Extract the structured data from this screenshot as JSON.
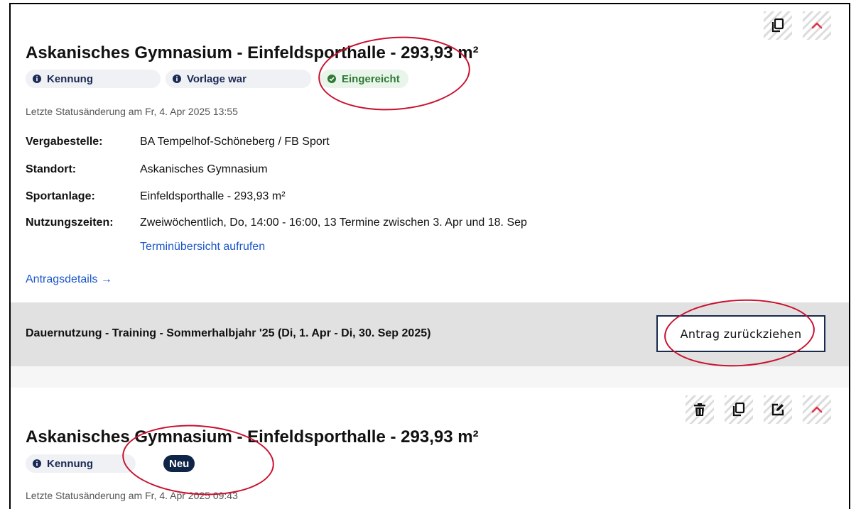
{
  "cards": [
    {
      "title": "Askanisches Gymnasium - Einfeldsporthalle - 293,93 m²",
      "badges": {
        "kennung": "Kennung",
        "vorlage": "Vorlage war",
        "status": "Eingereicht"
      },
      "last_status_change": "Letzte Statusänderung am Fr, 4. Apr 2025 13:55",
      "details": [
        {
          "label": "Vergabestelle:",
          "value": "BA Tempelhof-Schöneberg / FB Sport"
        },
        {
          "label": "Standort:",
          "value": "Askanisches Gymnasium"
        },
        {
          "label": "Sportanlage:",
          "value": "Einfeldsporthalle - 293,93 m²"
        },
        {
          "label": "Nutzungszeiten:",
          "value": "Zweiwöchentlich, Do, 14:00 - 16:00, 13 Termine zwischen 3. Apr und 18. Sep"
        }
      ],
      "schedule_link": "Terminübersicht aufrufen",
      "details_link": "Antragsdetails →",
      "usage_period": "Dauernutzung - Training - Sommerhalbjahr '25 (Di, 1. Apr - Di, 30. Sep 2025)",
      "withdraw_button": "Antrag zurückziehen",
      "icons": [
        "copy-icon",
        "chevron-up-icon"
      ]
    },
    {
      "title": "Askanisches Gymnasium - Einfeldsporthalle - 293,93 m²",
      "badges": {
        "kennung": "Kennung",
        "status": "Neu"
      },
      "last_status_change": "Letzte Statusänderung am Fr, 4. Apr 2025 09:43",
      "icons": [
        "trash-icon",
        "copy-icon",
        "edit-icon",
        "chevron-up-icon"
      ]
    }
  ],
  "colors": {
    "annotation": "#c8102e",
    "link": "#1a56c9",
    "badge_navy": "#0f2547",
    "status_green": "#2f7a37"
  }
}
